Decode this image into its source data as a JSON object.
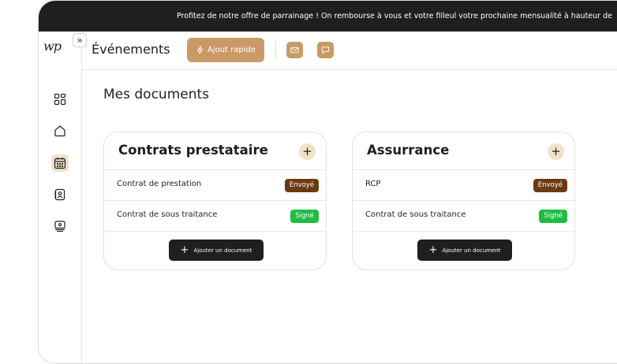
{
  "promo": {
    "text": "Profitez de notre offre de parrainage ! On rembourse à vous et votre filleul votre prochaine mensualité à hauteur de"
  },
  "logo": {
    "text": "wp"
  },
  "sidebar": {
    "expand_icon": "chevrons-right-icon",
    "items": [
      {
        "name": "dashboard-icon",
        "active": false
      },
      {
        "name": "home-icon",
        "active": false
      },
      {
        "name": "calendar-icon",
        "active": true
      },
      {
        "name": "contacts-icon",
        "active": false
      },
      {
        "name": "monitor-icon",
        "active": false
      }
    ]
  },
  "topbar": {
    "title": "Événements",
    "quick_add_label": "Ajout rapide",
    "quick_add_icon": "lightning-icon",
    "mail_icon": "mail-icon",
    "chat_icon": "chat-icon"
  },
  "main": {
    "title": "Mes documents",
    "cards": [
      {
        "title": "Contrats prestataire",
        "add_symbol": "+",
        "rows": [
          {
            "label": "Contrat de prestation",
            "status": "Envoyé",
            "status_type": "sent"
          },
          {
            "label": "Contrat de sous traitance",
            "status": "Signé",
            "status_type": "signed"
          }
        ],
        "add_doc_symbol": "+",
        "add_doc_label": "Ajouter un document"
      },
      {
        "title": "Assurrance",
        "add_symbol": "+",
        "rows": [
          {
            "label": "RCP",
            "status": "Envoyé",
            "status_type": "sent"
          },
          {
            "label": "Contrat de sous traitance",
            "status": "Signé",
            "status_type": "signed"
          }
        ],
        "add_doc_symbol": "+",
        "add_doc_label": "Ajouter un document"
      }
    ]
  },
  "colors": {
    "accent": "#c99a66",
    "accent_light": "#f1e2c8",
    "dark": "#1f1f1f",
    "sent": "#6b3a12",
    "signed": "#1fbd43"
  }
}
